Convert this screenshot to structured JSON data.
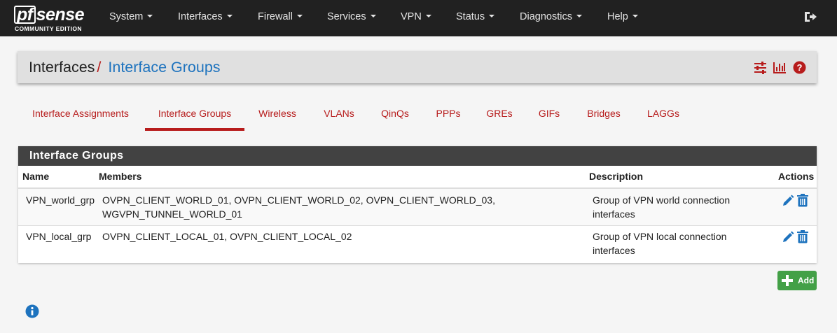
{
  "brand": {
    "logo_pf": "pf",
    "logo_sense": "sense",
    "edition": "COMMUNITY EDITION"
  },
  "navbar": {
    "items": [
      "System",
      "Interfaces",
      "Firewall",
      "Services",
      "VPN",
      "Status",
      "Diagnostics",
      "Help"
    ],
    "logout_icon": "sign-out-icon"
  },
  "breadcrumb": {
    "root": "Interfaces",
    "separator": "/",
    "current": "Interface Groups"
  },
  "header_icons": [
    "sliders-icon",
    "bar-chart-icon",
    "question-circle-icon"
  ],
  "tabs": {
    "items": [
      "Interface Assignments",
      "Interface Groups",
      "Wireless",
      "VLANs",
      "QinQs",
      "PPPs",
      "GREs",
      "GIFs",
      "Bridges",
      "LAGGs"
    ],
    "active": "Interface Groups"
  },
  "panel": {
    "title": "Interface Groups",
    "columns": {
      "name": "Name",
      "members": "Members",
      "description": "Description",
      "actions": "Actions"
    },
    "rows": [
      {
        "name": "VPN_world_grp",
        "members_line1": "OVPN_CLIENT_WORLD_01, OVPN_CLIENT_WORLD_02, OVPN_CLIENT_WORLD_03,",
        "members_line2": "WGVPN_TUNNEL_WORLD_01",
        "description_line1": "Group of VPN world connection",
        "description_line2": "interfaces"
      },
      {
        "name": "VPN_local_grp",
        "members_line1": "OVPN_CLIENT_LOCAL_01, OVPN_CLIENT_LOCAL_02",
        "members_line2": "",
        "description_line1": "Group of VPN local connection",
        "description_line2": "interfaces"
      }
    ],
    "row_actions": [
      "pencil-icon",
      "trash-icon"
    ]
  },
  "add_button": {
    "label": "Add",
    "icon": "plus-icon"
  },
  "footer_icon": "info-circle-icon",
  "colors": {
    "navbar": "#212121",
    "page_bg": "#f5f5f5",
    "header_bg": "#e0e0e0",
    "accent_red": "#b71c1c",
    "link_blue": "#1e73be",
    "panel_heading": "#424242",
    "add_green": "#43a047"
  }
}
